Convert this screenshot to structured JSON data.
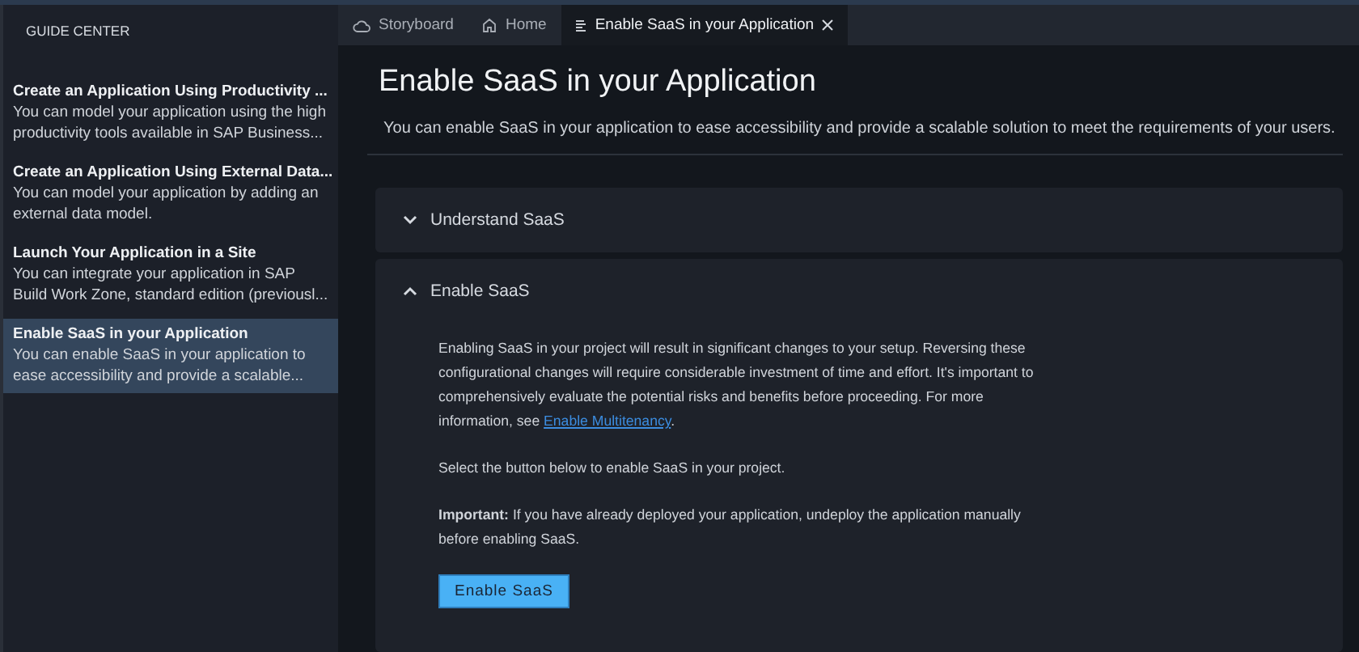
{
  "sidebar": {
    "title": "GUIDE CENTER",
    "items": [
      {
        "title": "Create an Application Using Productivity ...",
        "description": "You can model your application using the high productivity tools available in SAP Business...",
        "selected": false
      },
      {
        "title": "Create an Application Using External Data...",
        "description": "You can model your application by adding an external data model.",
        "selected": false
      },
      {
        "title": "Launch Your Application in a Site",
        "description": "You can integrate your application in SAP Build Work Zone, standard edition (previousl...",
        "selected": false
      },
      {
        "title": "Enable SaaS in your Application",
        "description": "You can enable SaaS in your application to ease accessibility and provide a scalable...",
        "selected": true
      }
    ]
  },
  "tabs": [
    {
      "label": "Storyboard",
      "selected": false,
      "closable": false
    },
    {
      "label": "Home",
      "selected": false,
      "closable": false
    },
    {
      "label": "Enable SaaS in your Application",
      "selected": true,
      "closable": true
    }
  ],
  "page": {
    "title": "Enable SaaS in your Application",
    "subtitle": "You can enable SaaS in your application to ease accessibility and provide a scalable solution to meet the requirements of your users."
  },
  "sections": [
    {
      "title": "Understand SaaS",
      "expanded": false
    },
    {
      "title": "Enable SaaS",
      "expanded": true,
      "content": [
        {
          "kind": "link_paragraph",
          "text": "Enabling SaaS in your project will result in significant changes to your setup. Reversing these configurational changes will require considerable investment of time and effort. It's important to comprehensively evaluate the potential risks and benefits before proceeding. For more information, see ",
          "link": "Enable Multitenancy",
          "after": "."
        },
        {
          "kind": "paragraph",
          "text": "Select the button below to enable SaaS in your project."
        },
        {
          "kind": "paragraph",
          "text": "**Important:** If you have already deployed your application, undeploy the application manually before enabling SaaS."
        },
        {
          "kind": "button",
          "text": "Enable SaaS"
        }
      ]
    }
  ]
}
